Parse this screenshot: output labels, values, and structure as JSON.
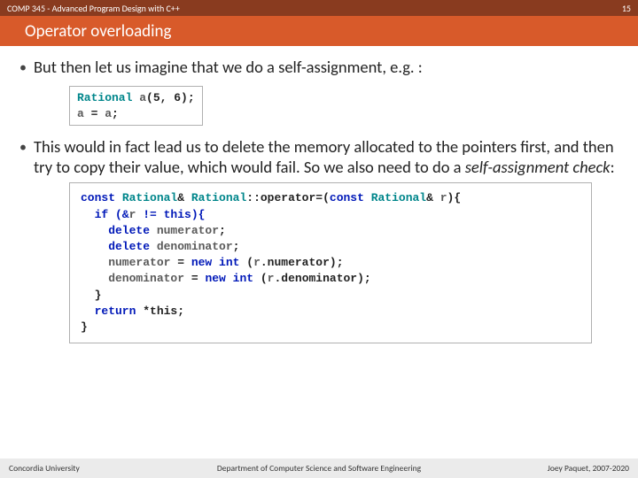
{
  "header": {
    "course": "COMP 345 - Advanced Program Design with C++",
    "pageNum": "15"
  },
  "title": "Operator overloading",
  "b1": {
    "text": "But then let us imagine that we do a self-assignment, e.g. :"
  },
  "code1": {
    "t1": "Rational",
    "t2": " a",
    "t3": "(5, 6);",
    "l2a": "a",
    "l2b": " = ",
    "l2c": "a",
    "l2d": ";"
  },
  "b2": {
    "p1": "This would in fact lead us to delete the memory allocated to the pointers first, and then try to copy their value, which would fail. So we also need to do a ",
    "em": "self-assignment check",
    "p2": ":"
  },
  "code2": {
    "l1a": "const ",
    "l1b": "Rational",
    "l1c": "& ",
    "l1d": "Rational",
    "l1e": "::operator=(",
    "l1f": "const ",
    "l1g": "Rational",
    "l1h": "& ",
    "l1i": "r",
    "l1j": "){",
    "l2a": "  if (&",
    "l2b": "r",
    "l2c": " != this){",
    "l3a": "    delete ",
    "l3b": "numerator",
    "l3c": ";",
    "l4a": "    delete ",
    "l4b": "denominator",
    "l4c": ";",
    "l5a": "    numerator",
    "l5b": " = ",
    "l5c": "new int ",
    "l5d": "(",
    "l5e": "r",
    "l5f": ".numerator);",
    "l6a": "    denominator",
    "l6b": " = ",
    "l6c": "new int ",
    "l6d": "(",
    "l6e": "r",
    "l6f": ".denominator);",
    "l7": "  }",
    "l8a": "  return ",
    "l8b": "*this;",
    "l9": "}"
  },
  "footer": {
    "left": "Concordia University",
    "center": "Department of Computer Science and Software Engineering",
    "right": "Joey Paquet, 2007-2020"
  }
}
